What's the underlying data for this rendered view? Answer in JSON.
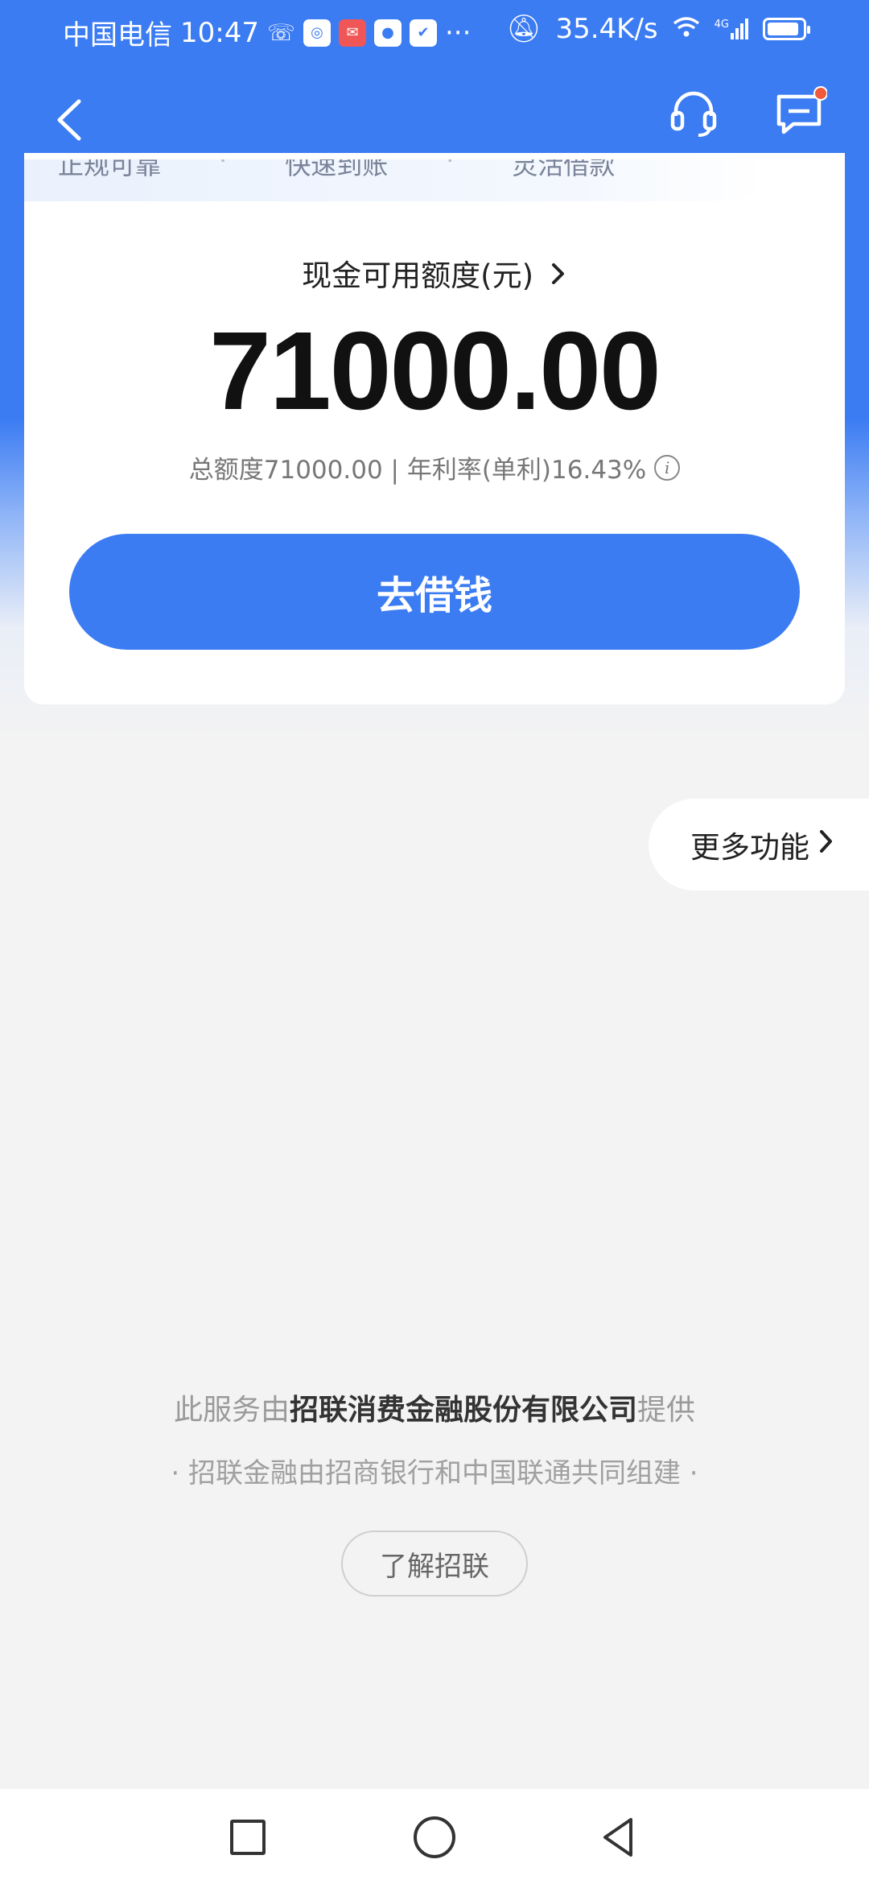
{
  "status_bar": {
    "carrier": "中国电信",
    "time": "10:47",
    "more": "···",
    "net_speed": "35.4K/s",
    "network": "4G"
  },
  "nav": {
    "back_icon": "chevron-left-icon",
    "service_icon": "headset-icon",
    "message_icon": "message-icon",
    "accent": "#3b7cf3",
    "badge_color": "#f05a3c"
  },
  "tagline": [
    "正规可靠",
    "快速到账",
    "灵活借款"
  ],
  "credit": {
    "label": "现金可用额度(元)",
    "amount": "71000.00",
    "total_label": "总额度71000.00 | 年利率(单利)16.43%"
  },
  "borrow_button": "去借钱",
  "more_features": "更多功能",
  "footer": {
    "provider_prefix": "此服务由",
    "provider_name": "招联消费金融股份有限公司",
    "provider_suffix": "提供",
    "joint_note": "· 招联金融由招商银行和中国联通共同组建 ·",
    "learn_button": "了解招联"
  }
}
